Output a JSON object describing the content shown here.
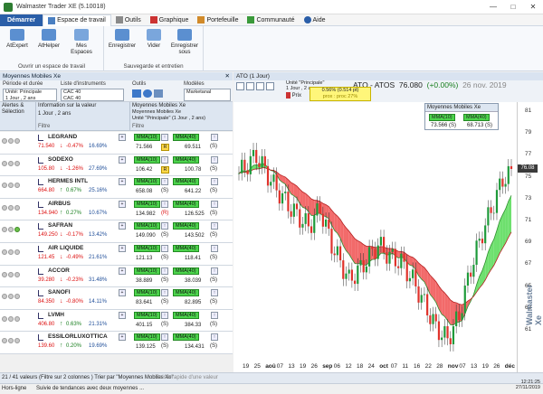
{
  "window": {
    "title": "Walmaster Trader XE  (5.10018)"
  },
  "menu": {
    "start": "Démarrer",
    "tabs": [
      "Espace de travail",
      "Outils",
      "Graphique",
      "Portefeuille",
      "Communauté",
      "Aide"
    ]
  },
  "ribbon": {
    "group1": {
      "label": "Ouvrir un espace de travail",
      "buttons": [
        "AtExpert",
        "AtHelper",
        "Mes Espaces"
      ]
    },
    "group2": {
      "label": "Sauvegarde et entretien",
      "buttons": [
        "Enregistrer",
        "Vider",
        "Enregistrer sous"
      ]
    }
  },
  "left": {
    "title": "Moyennes Mobiles Xe",
    "filters": {
      "periode_label": "Période et durée",
      "periode_value": "Unité: Principale",
      "periode_sub": "1 Jour , 2 ans",
      "liste_label": "Liste d'instruments",
      "liste_value": "CAC 40",
      "liste_sub": "CAC 40",
      "outils_label": "Outils",
      "modeles_label": "Modèles",
      "modeles_value": "Marketanal"
    },
    "columns": {
      "alertes": "Alertes & Sélection",
      "info": "Information sur la valeur",
      "info_sub": "1 Jour , 2 ans",
      "mm": "Moyennes Mobiles Xe",
      "mm_sub": "Moyennes Mobiles Xe",
      "mm_unit": "Unité \"Principale\" (1 Jour , 2 ans)",
      "filtre": "Filtre"
    },
    "rows": [
      {
        "name": "LEGRAND",
        "price": "71.540",
        "chg": "-0.47%",
        "dir": "down",
        "pct": "16.69%",
        "b1": "MMA(10)",
        "b2": "MMA(40)",
        "v1": "71.566",
        "s1": "R",
        "v2": "69.511",
        "s2": "(S)"
      },
      {
        "name": "SODEXO",
        "price": "105.80",
        "chg": "-1.26%",
        "dir": "down",
        "pct": "27.69%",
        "b1": "MMA(10)",
        "b2": "MMA(40)",
        "v1": "106.42",
        "s1": "R",
        "v2": "100.78",
        "s2": "(S)"
      },
      {
        "name": "HERMES INTL",
        "price": "664.80",
        "chg": "0.67%",
        "dir": "up",
        "pct": "25.16%",
        "b1": "MMA(10)",
        "b2": "MMA(40)",
        "v1": "658.08",
        "s1": "(S)",
        "v2": "641.22",
        "s2": "(S)"
      },
      {
        "name": "AIRBUS",
        "price": "134.940",
        "chg": "0.27%",
        "dir": "up",
        "pct": "10.67%",
        "b1": "MMA(10)",
        "b2": "MMA(40)",
        "v1": "134.982",
        "s1": "(R)",
        "v2": "126.525",
        "s2": "(S)"
      },
      {
        "name": "SAFRAN",
        "price": "149.250",
        "chg": "-0.17%",
        "dir": "down",
        "pct": "13.42%",
        "b1": "MMA(10)",
        "b2": "MMA(40)",
        "v1": "149.090",
        "s1": "(S)",
        "v2": "143.502",
        "s2": "(S)"
      },
      {
        "name": "AIR LIQUIDE",
        "price": "121.45",
        "chg": "-0.49%",
        "dir": "down",
        "pct": "21.61%",
        "b1": "MMA(10)",
        "b2": "MMA(40)",
        "v1": "121.13",
        "s1": "(S)",
        "v2": "118.41",
        "s2": "(S)"
      },
      {
        "name": "ACCOR",
        "price": "39.280",
        "chg": "-0.23%",
        "dir": "down",
        "pct": "31.48%",
        "b1": "MMA(10)",
        "b2": "MMA(40)",
        "v1": "38.889",
        "s1": "(S)",
        "v2": "38.039",
        "s2": "(S)"
      },
      {
        "name": "SANOFI",
        "price": "84.350",
        "chg": "-0.80%",
        "dir": "down",
        "pct": "14.11%",
        "b1": "MMA(10)",
        "b2": "MMA(40)",
        "v1": "83.641",
        "s1": "(S)",
        "v2": "82.895",
        "s2": "(S)"
      },
      {
        "name": "LVMH",
        "price": "406.80",
        "chg": "0.63%",
        "dir": "up",
        "pct": "21.31%",
        "b1": "MMA(10)",
        "b2": "MMA(40)",
        "v1": "401.15",
        "s1": "(S)",
        "v2": "384.33",
        "s2": "(S)"
      },
      {
        "name": "ESSILORLUXOTTICA",
        "price": "139.60",
        "chg": "0.20%",
        "dir": "up",
        "pct": "19.69%",
        "b1": "MMA(10)",
        "b2": "MMA(40)",
        "v1": "139.125",
        "s1": "(S)",
        "v2": "134.431",
        "s2": "(S)"
      }
    ]
  },
  "chart": {
    "panel_title": "ATO (1 Jour)",
    "unit_label": "Unité \"Principale\"",
    "unit_sub": "1 Jour , 2 ans",
    "prix": "Prix",
    "symbol": "ATO - ATOS",
    "last": "76.080",
    "change": "(+0.00%)",
    "date": "26 nov. 2019",
    "yellow_top": "0.56% (0.514 pt)",
    "yellow_bot": "prox : proc 27%",
    "legend_title": "Moyennes Mobiles Xe",
    "legend_b1": "MMA(10)",
    "legend_b2": "MMA(40)",
    "legend_v1": "73.566",
    "legend_v2": "68.713",
    "legend_s1": "(S)",
    "legend_s2": "(S)",
    "last_tag": "76.08",
    "watermark": "Walmaster Xe",
    "yticks": [
      "81",
      "79",
      "77",
      "75",
      "73",
      "71",
      "69",
      "67",
      "65",
      "63",
      "61"
    ],
    "xticks": [
      {
        "t": "19",
        "b": false
      },
      {
        "t": "25",
        "b": false
      },
      {
        "t": "aoû",
        "b": true
      },
      {
        "t": "07",
        "b": false
      },
      {
        "t": "13",
        "b": false
      },
      {
        "t": "19",
        "b": false
      },
      {
        "t": "26",
        "b": false
      },
      {
        "t": "sep",
        "b": true
      },
      {
        "t": "06",
        "b": false
      },
      {
        "t": "12",
        "b": false
      },
      {
        "t": "18",
        "b": false
      },
      {
        "t": "24",
        "b": false
      },
      {
        "t": "oct",
        "b": true
      },
      {
        "t": "07",
        "b": false
      },
      {
        "t": "11",
        "b": false
      },
      {
        "t": "16",
        "b": false
      },
      {
        "t": "22",
        "b": false
      },
      {
        "t": "28",
        "b": false
      },
      {
        "t": "nov",
        "b": true
      },
      {
        "t": "07",
        "b": false
      },
      {
        "t": "13",
        "b": false
      },
      {
        "t": "19",
        "b": false
      },
      {
        "t": "26",
        "b": false
      },
      {
        "t": "déc",
        "b": true
      }
    ]
  },
  "status": {
    "left": "21 / 41 valeurs (Filtre sur 2 colonnes ) Trier par \"Moyennes Mobiles Xe\"",
    "hint": "Saisie rapide d'une valeur",
    "bottom_left": "Hors-ligne",
    "bottom_mid": "Suivie de tendances avec deux moyennes ...",
    "time": "12:21:25",
    "date": "27/11/2019"
  },
  "colors": {
    "accent": "#2a5ea8",
    "green_fill": "#6ee06e",
    "red_fill": "#f26a6a"
  }
}
